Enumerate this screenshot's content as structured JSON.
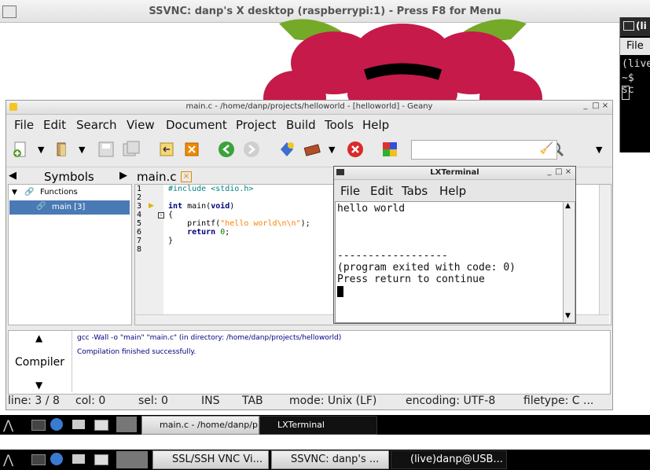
{
  "ssvnc": {
    "title": "SSVNC: danp's X desktop (raspberrypi:1) - Press F8 for Menu"
  },
  "right_terminal": {
    "title": "(li",
    "menu": "File",
    "line1": "(live",
    "line2": "~$ sc"
  },
  "geany": {
    "title": "main.c - /home/danp/projects/helloworld - [helloworld] - Geany",
    "menu": [
      "File",
      "Edit",
      "Search",
      "View",
      "Document",
      "Project",
      "Build",
      "Tools",
      "Help"
    ],
    "sidebar_tab": "Symbols",
    "file_tab": "main.c",
    "symbols": {
      "group": "Functions",
      "item": "main [3]"
    },
    "line_numbers": [
      "1",
      "2",
      "3",
      "4",
      "5",
      "6",
      "7",
      "8"
    ],
    "code": {
      "l1_pre": "#include ",
      "l1_str": "<stdio.h>",
      "l3_kw": "int",
      "l3_mid": " main(",
      "l3_kw2": "void",
      "l3_end": ")",
      "l4": "{",
      "l5_fn": "    printf(",
      "l5_str": "\"hello world\\n\\n\"",
      "l5_end": ");",
      "l6_kw": "    return",
      "l6_num": " 0",
      "l6_end": ";",
      "l7": "}"
    },
    "compiler": {
      "tab_label": "Compiler",
      "line1": "gcc -Wall -o \"main\" \"main.c\" (in directory: /home/danp/projects/helloworld)",
      "line2": "Compilation finished successfully."
    },
    "status": {
      "line": "line: 3 / 8",
      "col": "col: 0",
      "sel": "sel: 0",
      "ins": "INS",
      "tab": "TAB",
      "mode": "mode: Unix (LF)",
      "encoding": "encoding: UTF-8",
      "filetype": "filetype: C ..."
    }
  },
  "lxterminal": {
    "title": "LXTerminal",
    "menu": [
      "File",
      "Edit",
      "Tabs",
      "Help"
    ],
    "lines": [
      "hello world",
      "",
      "",
      "",
      "------------------",
      "(program exited with code: 0)",
      "Press return to continue"
    ]
  },
  "taskbar_inner": {
    "tasks": [
      "main.c - /home/danp/pr...",
      "LXTerminal"
    ]
  },
  "taskbar_outer": {
    "tasks": [
      "SSL/SSH VNC Vi...",
      "SSVNC: danp's ...",
      "(live)danp@USB..."
    ]
  },
  "colors": {
    "keyword": "#00007f",
    "string": "#ff8000",
    "number": "#007f00",
    "compiler_text": "#00007f",
    "raspberry_red": "#c51a4a",
    "raspberry_leaf": "#75a928"
  }
}
